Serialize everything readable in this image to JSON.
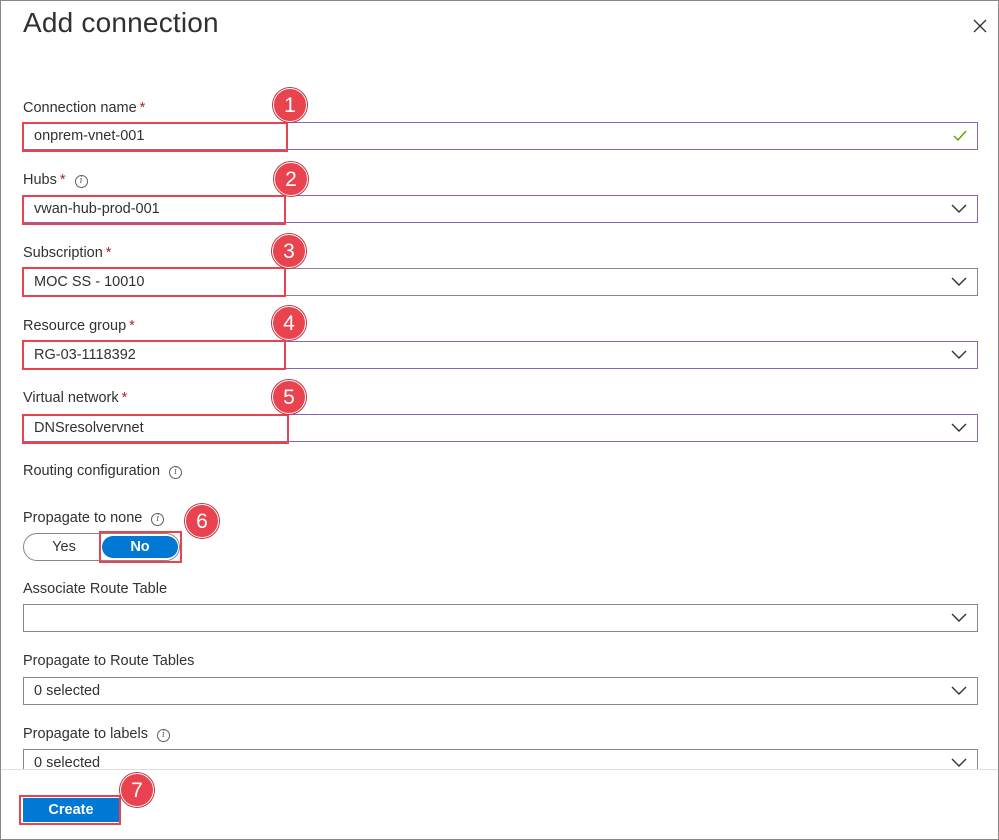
{
  "header": {
    "title": "Add connection"
  },
  "form": {
    "connection_name": {
      "label": "Connection name",
      "required": "*",
      "value": "onprem-vnet-001"
    },
    "hubs": {
      "label": "Hubs",
      "required": "*",
      "value": "vwan-hub-prod-001"
    },
    "subscription": {
      "label": "Subscription",
      "required": "*",
      "value": "MOC SS - 10010"
    },
    "resource_group": {
      "label": "Resource group",
      "required": "*",
      "value": "RG-03-1118392"
    },
    "virtual_network": {
      "label": "Virtual network",
      "required": "*",
      "value": "DNSresolvervnet"
    },
    "routing_configuration": {
      "label": "Routing configuration"
    },
    "propagate_to_none": {
      "label": "Propagate to none",
      "options": [
        "Yes",
        "No"
      ],
      "selected": "No"
    },
    "associate_route_table": {
      "label": "Associate Route Table",
      "value": ""
    },
    "propagate_to_route_tables": {
      "label": "Propagate to Route Tables",
      "value": "0 selected"
    },
    "propagate_to_labels": {
      "label": "Propagate to labels",
      "value": "0 selected"
    }
  },
  "callouts": [
    "1",
    "2",
    "3",
    "4",
    "5",
    "6",
    "7"
  ],
  "footer": {
    "create_label": "Create"
  },
  "colors": {
    "accent": "#0078d4",
    "highlight": "#e8434f",
    "active_border": "#8764b8",
    "valid_check": "#57a300",
    "required": "#a4262c"
  }
}
